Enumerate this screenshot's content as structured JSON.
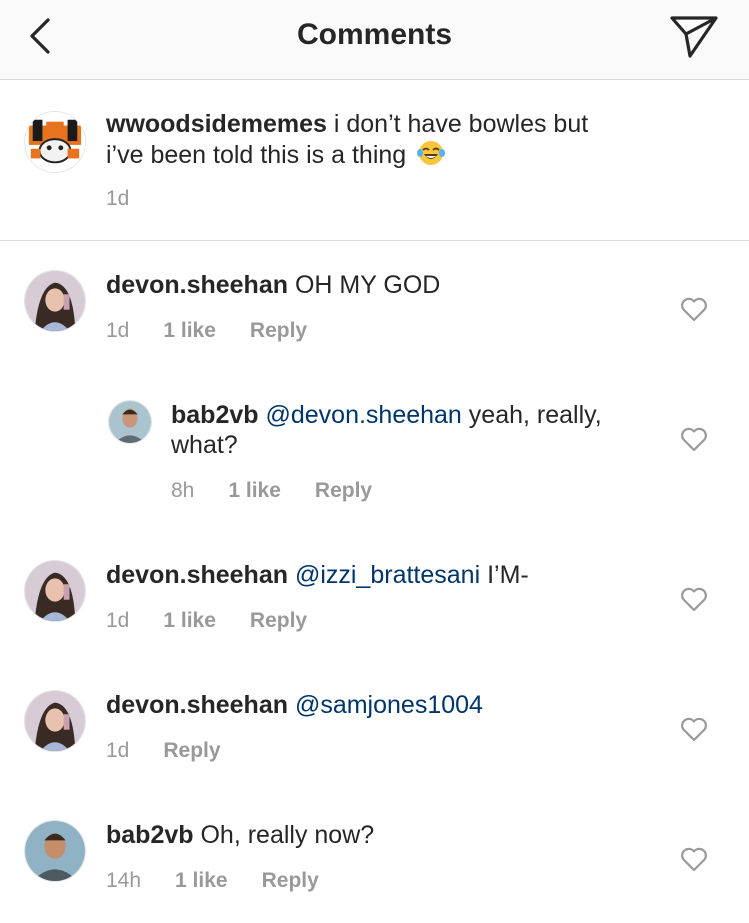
{
  "header": {
    "title": "Comments",
    "back_icon": "chevron-left-icon",
    "send_icon": "paper-plane-icon"
  },
  "caption": {
    "username": "wwoodsidememes",
    "text_line1": " i don’t have bowles but",
    "text_line2": "i’ve been told this is a thing",
    "emoji": "tears-of-joy-emoji",
    "time": "1d"
  },
  "comments": [
    {
      "username": "devon.sheehan",
      "mention": "",
      "text": " OH MY GOD",
      "time": "1d",
      "likes": "1 like",
      "reply": "Reply"
    },
    {
      "username": "bab2vb",
      "mention": " @devon.sheehan",
      "text": " yeah, really,",
      "text_line2": "what?",
      "time": "8h",
      "likes": "1 like",
      "reply": "Reply"
    },
    {
      "username": "devon.sheehan",
      "mention": " @izzi_brattesani",
      "text": " I’M-",
      "time": "1d",
      "likes": "1 like",
      "reply": "Reply"
    },
    {
      "username": "devon.sheehan",
      "mention": " @samjones1004",
      "text": "",
      "time": "1d",
      "likes": "",
      "reply": "Reply"
    },
    {
      "username": "bab2vb",
      "mention": "",
      "text": " Oh, really now?",
      "time": "14h",
      "likes": "1 like",
      "reply": "Reply"
    }
  ],
  "colors": {
    "text": "#262626",
    "mention": "#003569",
    "meta": "#999999",
    "header_bg": "#fafafa"
  }
}
